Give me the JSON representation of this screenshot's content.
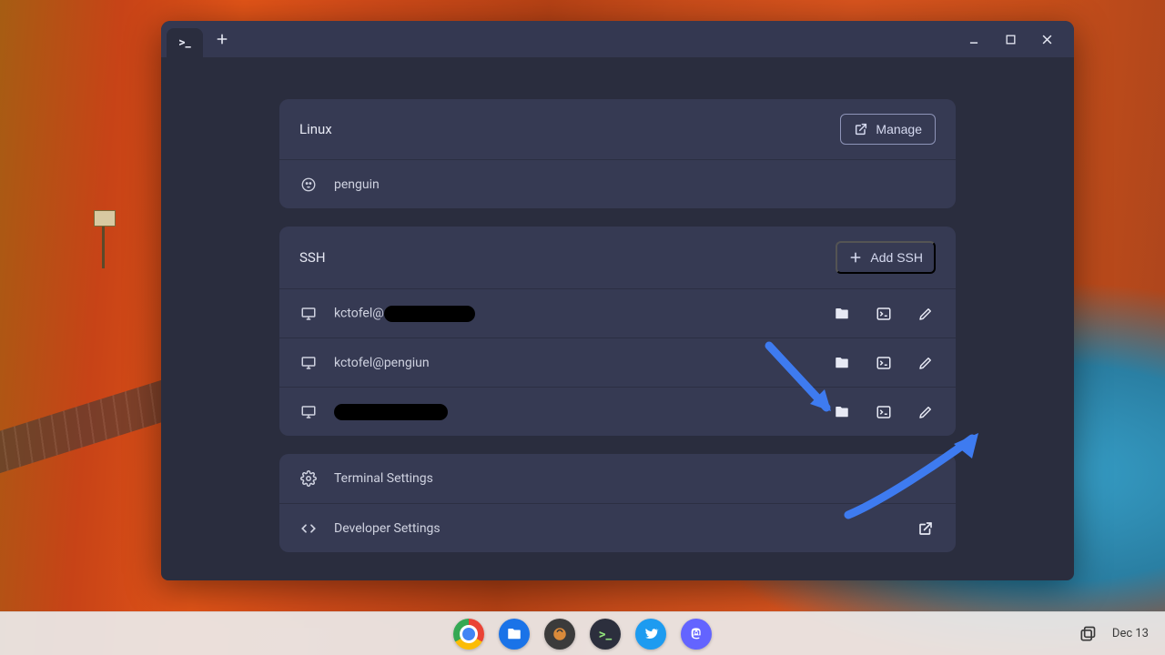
{
  "sections": {
    "linux": {
      "title": "Linux",
      "manage_label": "Manage",
      "items": [
        {
          "label": "penguin"
        }
      ]
    },
    "ssh": {
      "title": "SSH",
      "add_label": "Add SSH",
      "items": [
        {
          "label": "kctofel@",
          "redacted_after": true
        },
        {
          "label": "kctofel@pengiun"
        },
        {
          "label": "",
          "redacted_full": true
        }
      ]
    },
    "settings": {
      "terminal_label": "Terminal Settings",
      "developer_label": "Developer Settings"
    }
  },
  "shelf": {
    "date": "Dec 13"
  }
}
